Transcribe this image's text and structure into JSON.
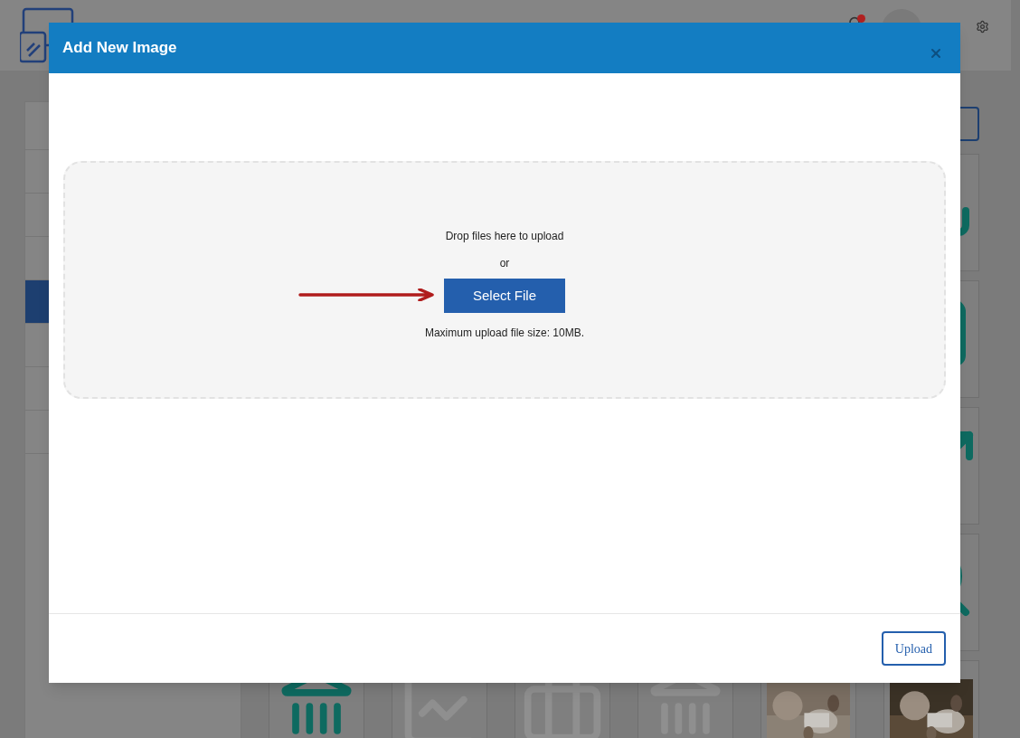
{
  "header": {
    "notification": true
  },
  "sidebar": {
    "items": [
      {
        "selected": false
      },
      {
        "selected": false
      },
      {
        "selected": false
      },
      {
        "selected": true
      },
      {
        "selected": false
      },
      {
        "selected": false
      },
      {
        "selected": false
      }
    ]
  },
  "gallery": [
    {
      "kind": "icon"
    },
    {
      "kind": "icon"
    },
    {
      "kind": "icon"
    },
    {
      "kind": "icon"
    },
    {
      "kind": "icon"
    },
    {
      "kind": "faded-icon"
    },
    {
      "kind": "faded-icon"
    },
    {
      "kind": "faded-icon"
    },
    {
      "kind": "picture"
    },
    {
      "kind": "picture"
    }
  ],
  "modal": {
    "title": "Add New Image",
    "dropzone": {
      "hint": "Drop files here to upload",
      "separator": "or",
      "button": "Select File",
      "note": "Maximum upload file size: 10MB."
    },
    "footer_button": "Upload"
  }
}
